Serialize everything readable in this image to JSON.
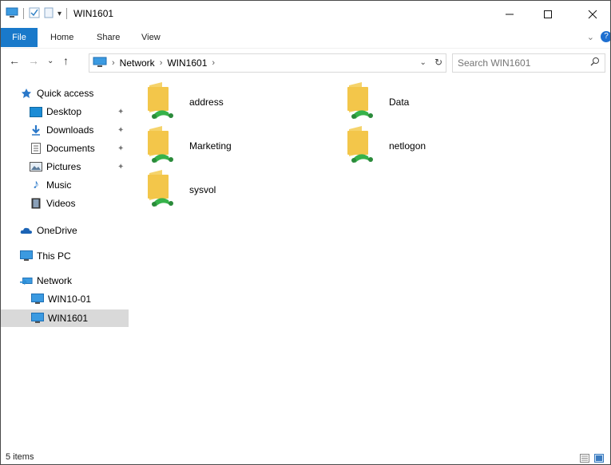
{
  "window": {
    "title": "WIN1601"
  },
  "ribbon": {
    "tabs": [
      "File",
      "Home",
      "Share",
      "View"
    ]
  },
  "address": {
    "path": [
      "Network",
      "WIN1601"
    ],
    "search_placeholder": "Search WIN1601"
  },
  "navpane": {
    "items": [
      {
        "label": "Quick access",
        "icon": "star-icon"
      },
      {
        "label": "Desktop",
        "icon": "desktop-icon",
        "pinned": true
      },
      {
        "label": "Downloads",
        "icon": "download-icon",
        "pinned": true
      },
      {
        "label": "Documents",
        "icon": "document-icon",
        "pinned": true
      },
      {
        "label": "Pictures",
        "icon": "pictures-icon",
        "pinned": true
      },
      {
        "label": "Music",
        "icon": "music-icon"
      },
      {
        "label": "Videos",
        "icon": "videos-icon"
      },
      {
        "label": "OneDrive",
        "icon": "cloud-icon"
      },
      {
        "label": "This PC",
        "icon": "computer-icon"
      },
      {
        "label": "Network",
        "icon": "network-icon"
      },
      {
        "label": "WIN10-01",
        "icon": "computer-icon"
      },
      {
        "label": "WIN1601",
        "icon": "computer-icon",
        "selected": true
      }
    ]
  },
  "content": {
    "folders": [
      "address",
      "Data",
      "Marketing",
      "netlogon",
      "sysvol"
    ]
  },
  "status": {
    "item_count": "5 items"
  },
  "colors": {
    "accent": "#1979ca",
    "selected": "#d9d9d9",
    "folder": "#f3c64a",
    "share": "#36b24a"
  }
}
